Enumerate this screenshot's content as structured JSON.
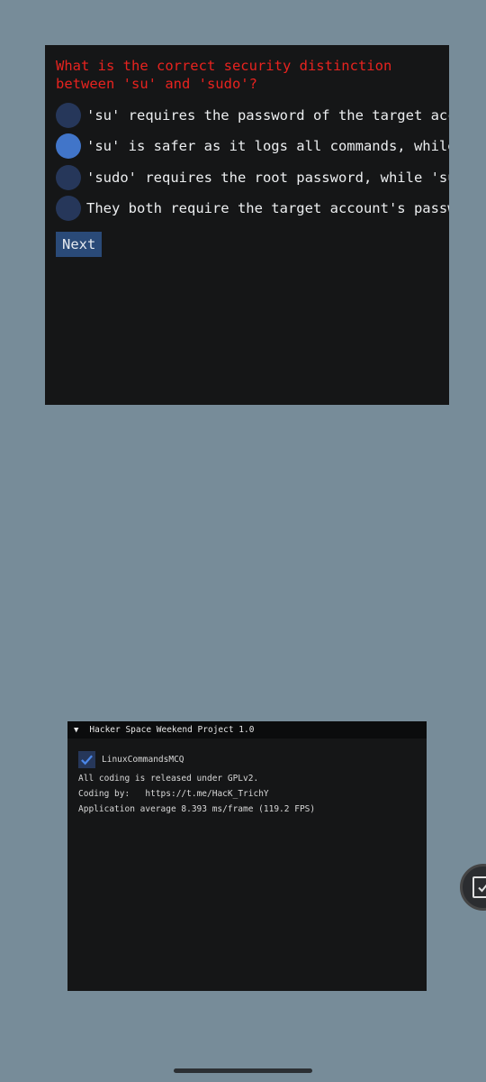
{
  "quiz": {
    "question": "What is the correct security distinction between 'su' and 'sudo'?",
    "options": [
      {
        "label": "'su' requires the password of the target account, while 'sudo' requires the user's own password",
        "selected": false
      },
      {
        "label": "'su' is safer as it logs all commands, while 'sudo' does not",
        "selected": true
      },
      {
        "label": "'sudo' requires the root password, while 'su' requires the user's own password",
        "selected": false
      },
      {
        "label": "They both require the target account's password",
        "selected": false
      }
    ],
    "next_label": "Next"
  },
  "info_window": {
    "title": "Hacker Space Weekend Project 1.0",
    "checkbox_label": "LinuxCommandsMCQ",
    "checkbox_checked": true,
    "license": "All coding is released under GPLv2.",
    "credit_prefix": "Coding by:",
    "credit_link": "https://t.me/HacK_TrichY",
    "stats": "Application average 8.393 ms/frame (119.2 FPS)"
  },
  "colors": {
    "background": "#778c99",
    "panel": "#151617",
    "question_text": "#e8231f",
    "radio": "#26375a",
    "radio_selected": "#4175c9",
    "button": "#2a4a78"
  }
}
